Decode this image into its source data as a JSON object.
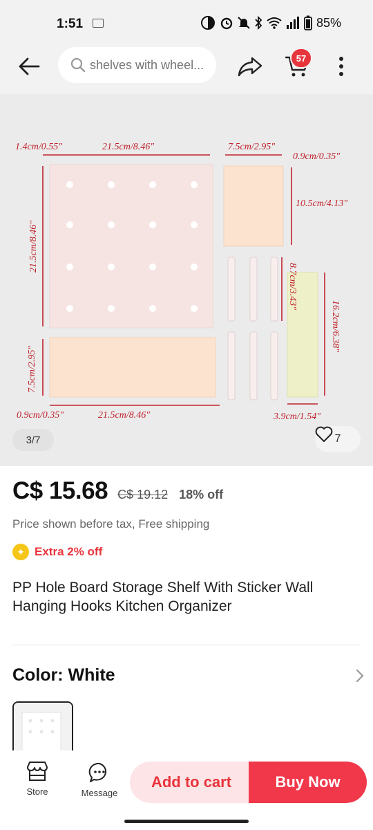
{
  "status_bar": {
    "time": "1:51",
    "battery": "85%"
  },
  "header": {
    "search_placeholder": "shelves with wheel...",
    "cart_count": "57"
  },
  "gallery": {
    "counter": "3/7",
    "wishlist_count": "7",
    "dimension_labels": {
      "top_left_thickness": "1.4cm/0.55\"",
      "board_width": "21.5cm/8.46\"",
      "small_panel_width": "7.5cm/2.95\"",
      "small_panel_thickness": "0.9cm/0.35\"",
      "small_panel_height": "10.5cm/4.13\"",
      "board_height": "21.5cm/8.46\"",
      "rod_length": "8.7cm/3.43\"",
      "sticker_height": "16.2cm/6.38\"",
      "shelf_height": "7.5cm/2.95\"",
      "shelf_thickness": "0.9cm/0.35\"",
      "shelf_width": "21.5cm/8.46\"",
      "sticker_width": "3.9cm/1.54\""
    }
  },
  "product": {
    "price_now": "C$ 15.68",
    "price_old": "C$ 19.12",
    "discount": "18% off",
    "tax_note": "Price shown before tax, Free shipping",
    "extra_discount": "Extra 2% off",
    "title": "PP Hole Board Storage Shelf With Sticker Wall Hanging Hooks Kitchen Organizer",
    "color_label": "Color: White"
  },
  "bottom_bar": {
    "store_label": "Store",
    "message_label": "Message",
    "add_to_cart": "Add to cart",
    "buy_now": "Buy Now"
  },
  "colors": {
    "accent_red": "#e8343b",
    "buy_button": "#f0384a",
    "cart_button_bg": "#fde5e7",
    "dimension_red": "#c0222c",
    "board_pink": "#f6e4e2",
    "shelf_peach": "#fbe3cf",
    "sticker_yellow": "#eef0c8"
  }
}
